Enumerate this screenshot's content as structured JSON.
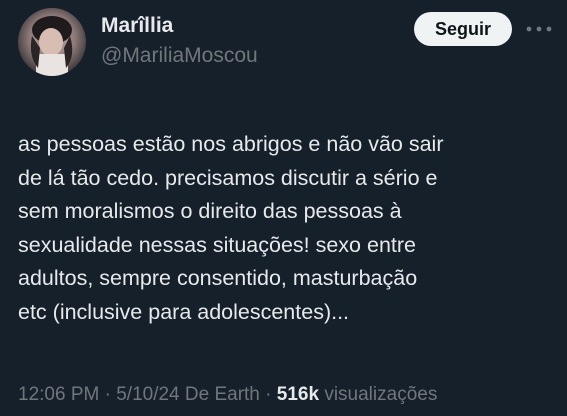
{
  "author": {
    "name": "Marîllia",
    "handle": "@MariliaMoscou",
    "avatar_icon": "profile-photo"
  },
  "actions": {
    "follow_label": "Seguir",
    "more_icon": "more-horizontal-icon"
  },
  "tweet": {
    "lines": [
      "as pessoas estão nos abrigos e não vão sair",
      "de lá tão cedo. precisamos discutir a sério e",
      "sem moralismos o direito das pessoas à",
      "sexualidade nessas situações! sexo entre",
      "adultos, sempre consentido, masturbação",
      "etc (inclusive para adolescentes)..."
    ]
  },
  "meta": {
    "time": "12:06 PM",
    "sep1": " · ",
    "date": "5/10/24 De Earth",
    "sep2": " · ",
    "views_count": "516k",
    "views_label": " visualizações"
  },
  "colors": {
    "background": "#15202b",
    "text": "#e7e9ea",
    "secondary": "#71767b",
    "button_bg": "#eff3f4",
    "button_text": "#0f1419"
  }
}
